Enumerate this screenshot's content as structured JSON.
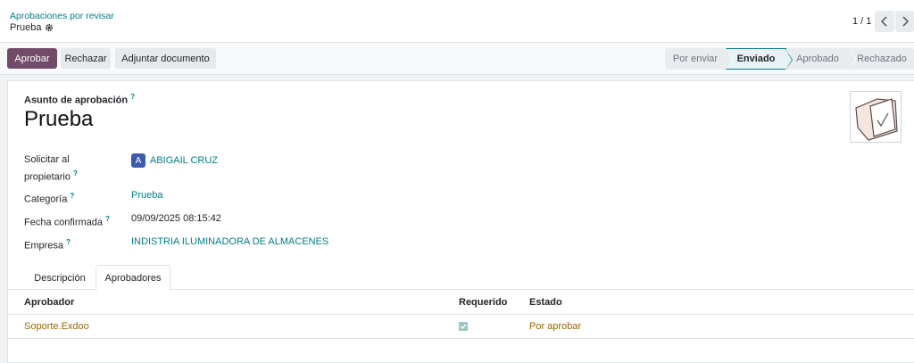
{
  "breadcrumb": {
    "parent": "Aprobaciones por revisar",
    "current": "Prueba"
  },
  "pager": {
    "value": "1 / 1",
    "prev_icon": "chevron-left-icon",
    "next_icon": "chevron-right-icon"
  },
  "actions": {
    "approve": "Aprobar",
    "reject": "Rechazar",
    "attach": "Adjuntar documento"
  },
  "status": {
    "stages": [
      "Por enviar",
      "Enviado",
      "Aprobado",
      "Rechazado"
    ],
    "active": "Enviado"
  },
  "form": {
    "subject_label": "Asunto de aprobación",
    "title": "Prueba",
    "fields": {
      "owner_label_1": "Solicitar al",
      "owner_label_2": "propietario",
      "owner_initial": "A",
      "owner_value": "ABIGAIL CRUZ",
      "category_label": "Categoría",
      "category_value": "Prueba",
      "date_label": "Fecha confirmada",
      "date_value": "09/09/2025 08:15:42",
      "company_label": "Empresa",
      "company_value": "INDISTRIA ILUMINADORA DE ALMACENES"
    },
    "help_mark": "?"
  },
  "tabs": [
    "Descripción",
    "Aprobadores"
  ],
  "approvers_table": {
    "columns": [
      "Aprobador",
      "Requerido",
      "Estado"
    ],
    "rows": [
      {
        "approver": "Soporte.Exdoo",
        "required": true,
        "status": "Por aprobar"
      }
    ]
  },
  "colors": {
    "primary": "#714b67",
    "link": "#017e84",
    "warning_text": "#9a6700",
    "avatar_badge": "#3b5bad"
  }
}
